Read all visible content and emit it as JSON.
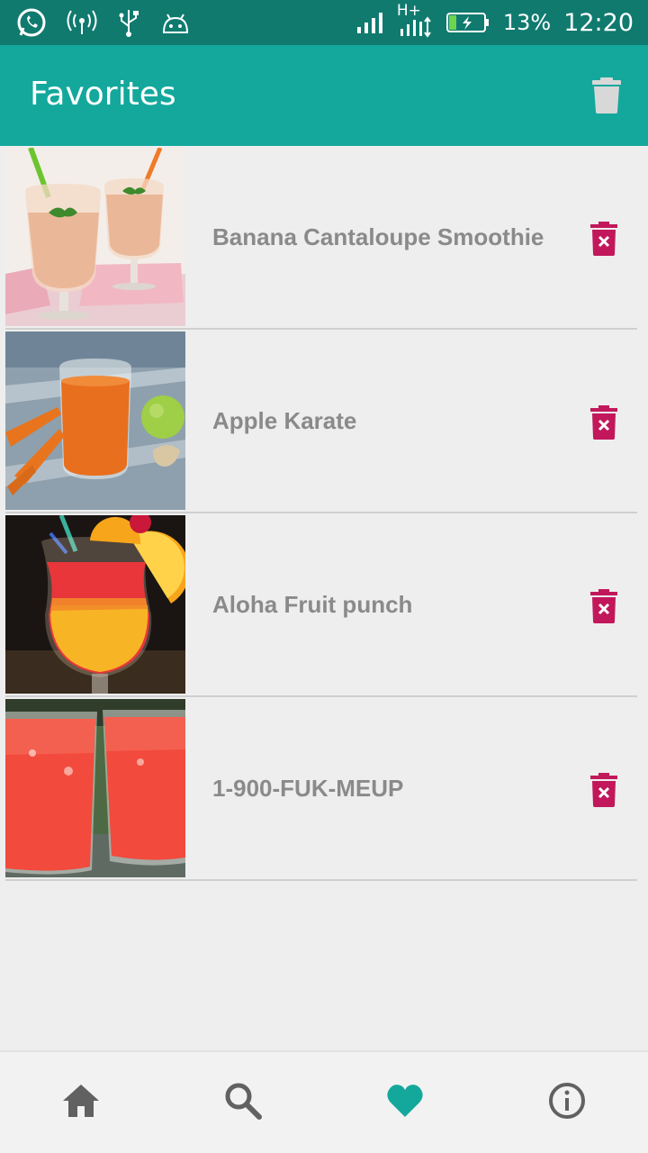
{
  "status_bar": {
    "battery": "13%",
    "time": "12:20",
    "network": "H+",
    "icons": [
      "whatsapp-icon",
      "hotspot-icon",
      "usb-icon",
      "android-icon",
      "signal-icon",
      "network-icon",
      "battery-icon"
    ]
  },
  "app_bar": {
    "title": "Favorites",
    "clear_icon": "trash-icon"
  },
  "favorites": [
    {
      "name": "Banana Cantaloupe Smoothie",
      "image": "smoothie-photo"
    },
    {
      "name": "Apple Karate",
      "image": "carrot-juice-photo"
    },
    {
      "name": "Aloha Fruit punch",
      "image": "fruit-punch-photo"
    },
    {
      "name": "1-900-FUK-MEUP",
      "image": "red-drinks-photo"
    }
  ],
  "bottom_nav": {
    "items": [
      {
        "icon": "home-icon",
        "active": false
      },
      {
        "icon": "search-icon",
        "active": false
      },
      {
        "icon": "heart-icon",
        "active": true
      },
      {
        "icon": "info-icon",
        "active": false
      }
    ]
  },
  "colors": {
    "status_bar": "#107a6f",
    "app_bar": "#14a89c",
    "accent": "#14a89c",
    "delete": "#c2185b",
    "item_text": "#8a8a8a",
    "nav_inactive": "#616161"
  }
}
